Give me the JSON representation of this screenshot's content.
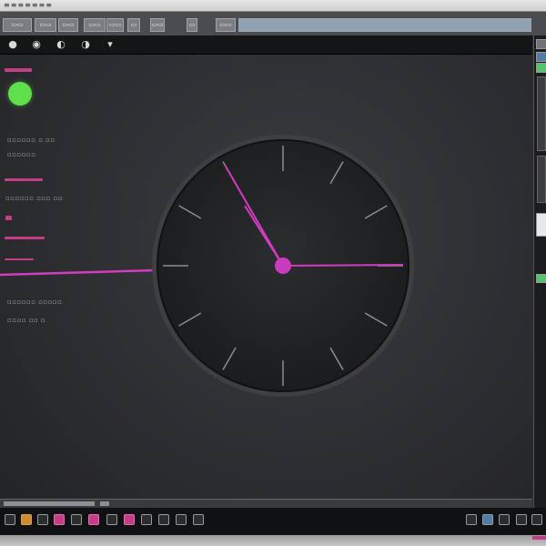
{
  "window": {
    "title": "≡≡≡≡≡≡≡"
  },
  "tabs": [
    {
      "label": "▭▭"
    },
    {
      "label": "▭▭"
    },
    {
      "label": "▭▭"
    },
    {
      "label": "▭▭"
    },
    {
      "label": "▭▭"
    },
    {
      "label": "▭"
    },
    {
      "label": "▭▭"
    },
    {
      "label": "▭"
    },
    {
      "label": "▭▭"
    },
    {
      "label": ""
    }
  ],
  "toolbar": {
    "items": [
      {
        "icon": "record-icon",
        "glyph": "●"
      },
      {
        "icon": "settings-icon",
        "glyph": "◉"
      },
      {
        "icon": "shield-icon",
        "glyph": "◐"
      },
      {
        "icon": "refresh-icon",
        "glyph": "◑"
      },
      {
        "icon": "dropdown-icon",
        "glyph": "▾"
      }
    ]
  },
  "side_panel": {
    "labels": [
      "▫▫▫▫▫▫ ▫ ▫▫",
      "▫▫▫▫▫▫",
      "▫▫▫▫▫▫ ▫▫▫ ▫▫",
      "▫▫▫▫▫▫ ▫▫▫▫▫",
      "▫▫▫▫ ▫▫ ▫",
      "▫▫▫▫▫▫ ▫ ▫▫"
    ]
  },
  "colors": {
    "accent": "#c43d86",
    "status": "#5de04b",
    "hand": "#d23cc0",
    "background": "#2a2b2d"
  },
  "clock": {
    "tick_count": 12,
    "hours": 10,
    "minutes": 55
  }
}
